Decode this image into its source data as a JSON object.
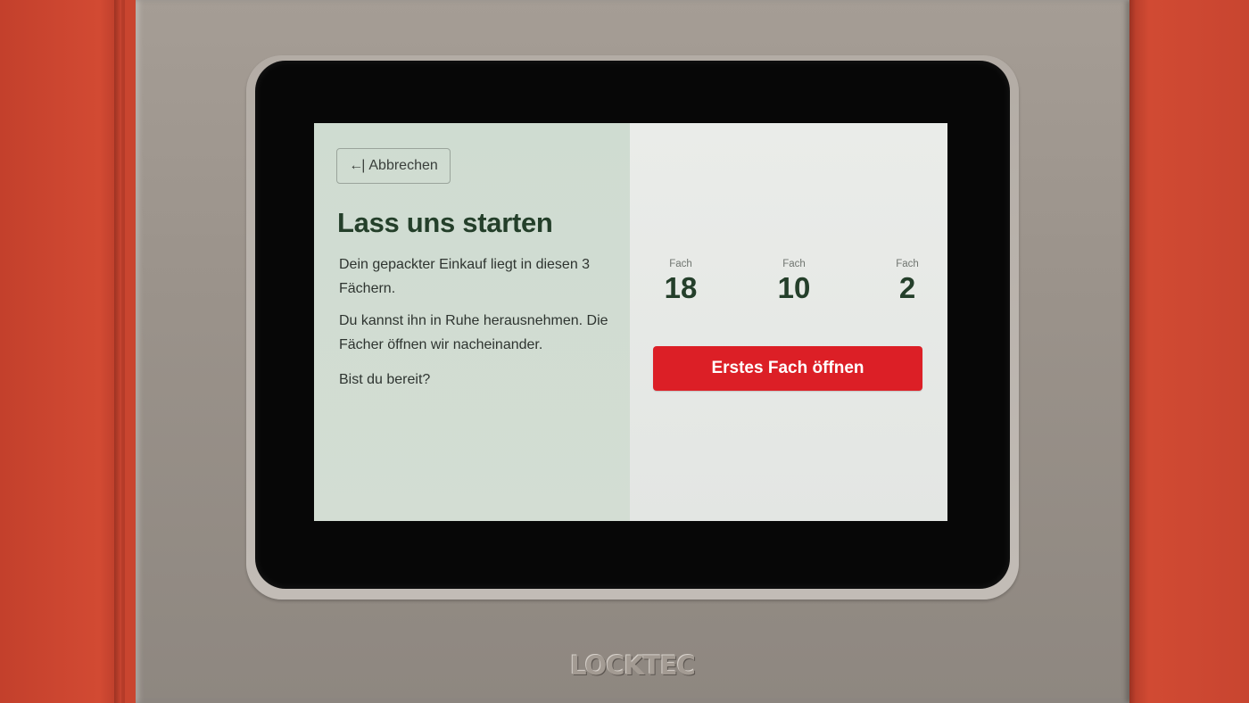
{
  "screen": {
    "cancel_button": {
      "icon": "arrow-left-to-bar-icon",
      "label": "Abbrechen"
    },
    "headline": "Lass uns starten",
    "paragraphs": [
      "Dein gepackter Einkauf liegt in diesen 3 Fächern.",
      "Du kannst ihn in Ruhe herausnehmen. Die Fächer öffnen wir nacheinander.",
      "Bist du bereit?"
    ],
    "compartments": [
      {
        "label": "Fach",
        "number": "18"
      },
      {
        "label": "Fach",
        "number": "10"
      },
      {
        "label": "Fach",
        "number": "2"
      }
    ],
    "primary_button": "Erstes Fach öffnen"
  },
  "device": {
    "brand": "LOCKTEC"
  },
  "colors": {
    "accent_red": "#dc1f26",
    "headline_green": "#243f2a",
    "left_pane_bg": "#cfdcd1",
    "right_pane_bg": "#eaece9"
  }
}
